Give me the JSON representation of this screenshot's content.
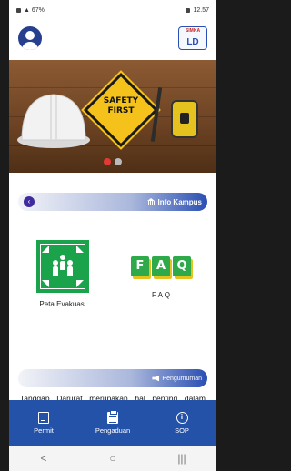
{
  "status_bar": {
    "left_text": "▲ 67%",
    "right_text": "12.57"
  },
  "app": {
    "logo_top": "SIMKA",
    "logo_main": "LD"
  },
  "banner": {
    "sign_line1": "SAFETY",
    "sign_line2": "FIRST",
    "slides_total": 2,
    "active_slide": 1
  },
  "info_section": {
    "title": "Info Kampus",
    "action_icon": "chevron-left-icon"
  },
  "menu": {
    "items": [
      {
        "label": "Peta Evakuasi",
        "icon": "evacuation-point-icon"
      },
      {
        "label": "F A Q",
        "icon": "faq-icon"
      }
    ],
    "faq_letters": [
      "F",
      "A",
      "Q"
    ]
  },
  "announcement": {
    "title": "Pengumuman",
    "text": "Tanggap Darurat merupakan hal penting dalam menangani kecelakaan berikutnya yang tidak di"
  },
  "bottom_nav": {
    "items": [
      {
        "label": "Permit",
        "icon": "permit-icon"
      },
      {
        "label": "Pengaduan",
        "icon": "clipboard-icon"
      },
      {
        "label": "SOP",
        "icon": "info-icon"
      }
    ]
  },
  "system_nav": {
    "back": "<",
    "home": "○",
    "recents": "|||"
  },
  "colors": {
    "primary": "#2452a8",
    "accent_red": "#e53935",
    "evac_green": "#1aa34a"
  }
}
